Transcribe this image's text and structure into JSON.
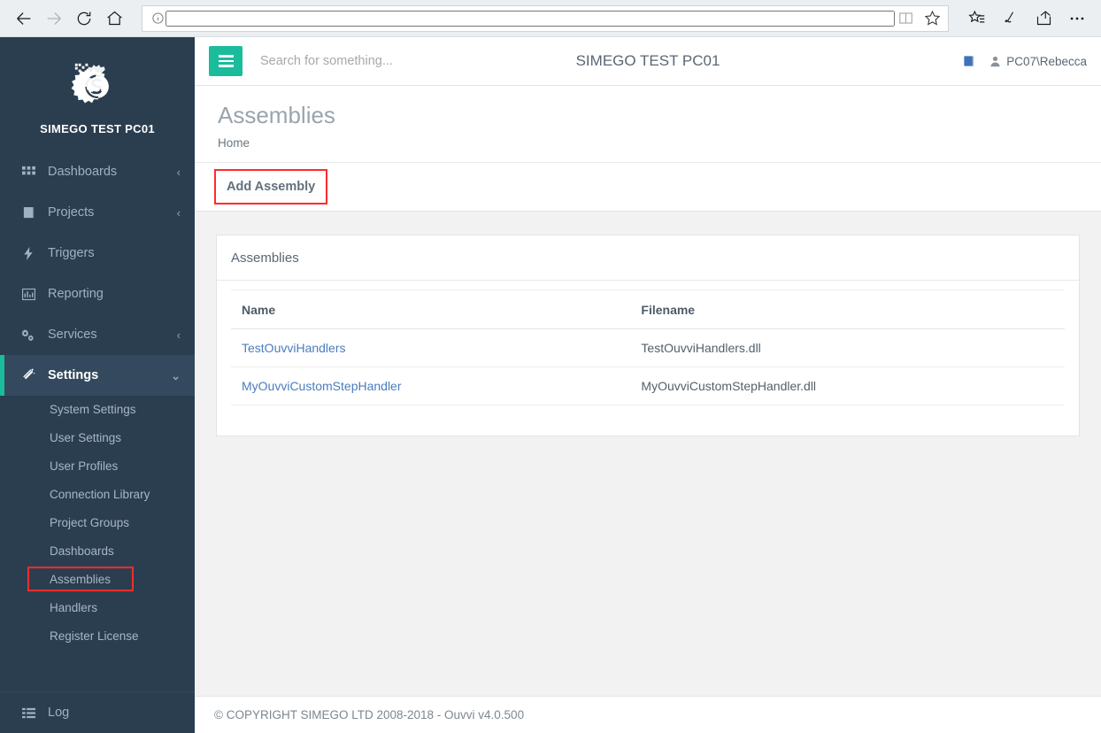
{
  "browser": {
    "back_icon": "arrow-left-icon",
    "forward_icon": "arrow-right-icon",
    "refresh_icon": "refresh-icon",
    "home_icon": "home-icon",
    "address_info_icon": "info-icon",
    "address_value": "",
    "address_placeholder": "",
    "reading_view_icon": "book-open-icon",
    "favorite_icon": "star-icon",
    "hub_icon": "star-list-icon",
    "notes_icon": "pen-icon",
    "share_icon": "share-icon",
    "more_icon": "ellipsis-icon"
  },
  "sidebar": {
    "brand": {
      "logo_icon": "simego-gear-s-logo",
      "name": "SIMEGO TEST PC01"
    },
    "items": [
      {
        "label": "Dashboards",
        "icon": "grid-icon",
        "caret": "‹",
        "active": false
      },
      {
        "label": "Projects",
        "icon": "book-icon",
        "caret": "‹",
        "active": false
      },
      {
        "label": "Triggers",
        "icon": "bolt-icon",
        "caret": "",
        "active": false
      },
      {
        "label": "Reporting",
        "icon": "bar-chart-icon",
        "caret": "",
        "active": false
      },
      {
        "label": "Services",
        "icon": "gears-icon",
        "caret": "‹",
        "active": false
      },
      {
        "label": "Settings",
        "icon": "magic-wand-icon",
        "caret": "⌄",
        "active": true
      }
    ],
    "submenu": [
      {
        "label": "System Settings",
        "highlighted": false
      },
      {
        "label": "User Settings",
        "highlighted": false
      },
      {
        "label": "User Profiles",
        "highlighted": false
      },
      {
        "label": "Connection Library",
        "highlighted": false
      },
      {
        "label": "Project Groups",
        "highlighted": false
      },
      {
        "label": "Dashboards",
        "highlighted": false
      },
      {
        "label": "Assemblies",
        "highlighted": true
      },
      {
        "label": "Handlers",
        "highlighted": false
      },
      {
        "label": "Register License",
        "highlighted": false
      }
    ],
    "bottom_item": {
      "label": "Log",
      "icon": "list-icon"
    }
  },
  "topbar": {
    "menu_toggle_icon": "hamburger-icon",
    "search_placeholder": "Search for something...",
    "search_value": "",
    "title": "SIMEGO TEST PC01",
    "help_icon": "blue-book-icon",
    "user_icon": "person-icon",
    "user_name": "PC07\\Rebecca"
  },
  "page": {
    "title": "Assemblies",
    "breadcrumb": "Home",
    "add_button_label": "Add Assembly"
  },
  "panel": {
    "title": "Assemblies",
    "columns": [
      "Name",
      "Filename"
    ],
    "rows": [
      {
        "name": "TestOuvviHandlers",
        "filename": "TestOuvviHandlers.dll"
      },
      {
        "name": "MyOuvviCustomStepHandler",
        "filename": "MyOuvviCustomStepHandler.dll"
      }
    ]
  },
  "footer": {
    "text": "© COPYRIGHT SIMEGO LTD 2008-2018 - Ouvvi v4.0.500"
  },
  "colors": {
    "sidebar_bg": "#2b3e50",
    "sidebar_active_bg": "#34495e",
    "accent_teal": "#1abc9c",
    "link_blue": "#4a7dbd",
    "annotation_red": "#ff2b2b",
    "content_bg": "#f2f2f2"
  }
}
